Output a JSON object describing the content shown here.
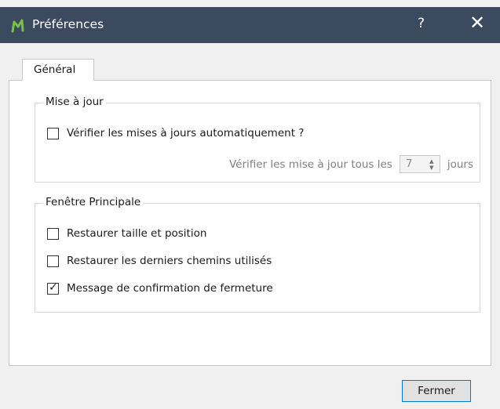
{
  "window": {
    "title": "Préférences",
    "help_label": "?",
    "close_label": "✕",
    "logo_color": "#7ac143"
  },
  "tabs": [
    {
      "label": "Général",
      "active": true
    }
  ],
  "groups": {
    "update": {
      "title": "Mise à jour",
      "auto_check": {
        "label": "Vérifier les mises à jours automatiquement ?",
        "checked": false
      },
      "interval": {
        "prefix": "Vérifier les mise à jour tous les",
        "value": "7",
        "suffix": "jours",
        "enabled": false
      }
    },
    "main_window": {
      "title": "Fenêtre Principale",
      "options": [
        {
          "label": "Restaurer taille et position",
          "checked": false
        },
        {
          "label": "Restaurer les derniers chemins utilisés",
          "checked": false
        },
        {
          "label": "Message de confirmation de fermeture",
          "checked": true
        }
      ]
    }
  },
  "footer": {
    "close_button_label": "Fermer"
  },
  "colors": {
    "titlebar": "#3b4a5e",
    "focus_border": "#0078d7"
  }
}
